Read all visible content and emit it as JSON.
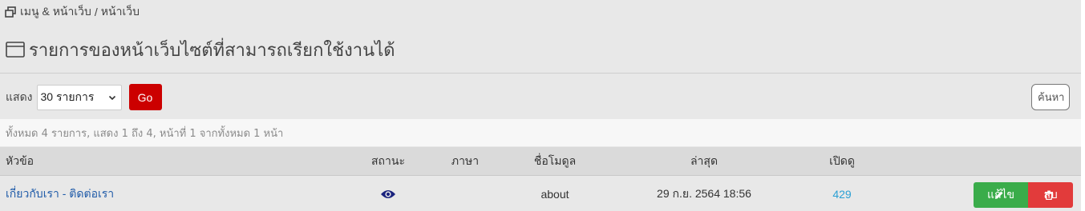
{
  "breadcrumb": {
    "icon": "windows-icon",
    "parent": "เมนู & หน้าเว็บ",
    "separator": "/",
    "current": "หน้าเว็บ"
  },
  "page": {
    "icon": "browser-window-icon",
    "title": "รายการของหน้าเว็บไซต์ที่สามารถเรียกใช้งานได้"
  },
  "toolbar": {
    "show_label": "แสดง",
    "per_page_selected": "30 รายการ",
    "go_label": "Go",
    "search_label": "ค้นหา"
  },
  "summary": "ทั้งหมด 4 รายการ, แสดง 1 ถึง 4, หน้าที่ 1 จากทั้งหมด 1 หน้า",
  "table": {
    "headers": {
      "title": "หัวข้อ",
      "status": "สถานะ",
      "language": "ภาษา",
      "module": "ชื่อโมดูล",
      "updated": "ล่าสุด",
      "views": "เปิดดู"
    },
    "rows": [
      {
        "title": "เกี่ยวกับเรา - ติดต่อเรา",
        "status_icon": "eye-icon",
        "language": "",
        "module": "about",
        "updated": "29 ก.ย. 2564 18:56",
        "views": "429",
        "edit_label": "แก้ไข",
        "delete_label": "ลบ"
      }
    ]
  },
  "colors": {
    "go_button": "#cc0000",
    "edit_button": "#3aac4a",
    "delete_button": "#e23b3b",
    "link": "#1e5aa8",
    "status_icon": "#1a237e"
  }
}
